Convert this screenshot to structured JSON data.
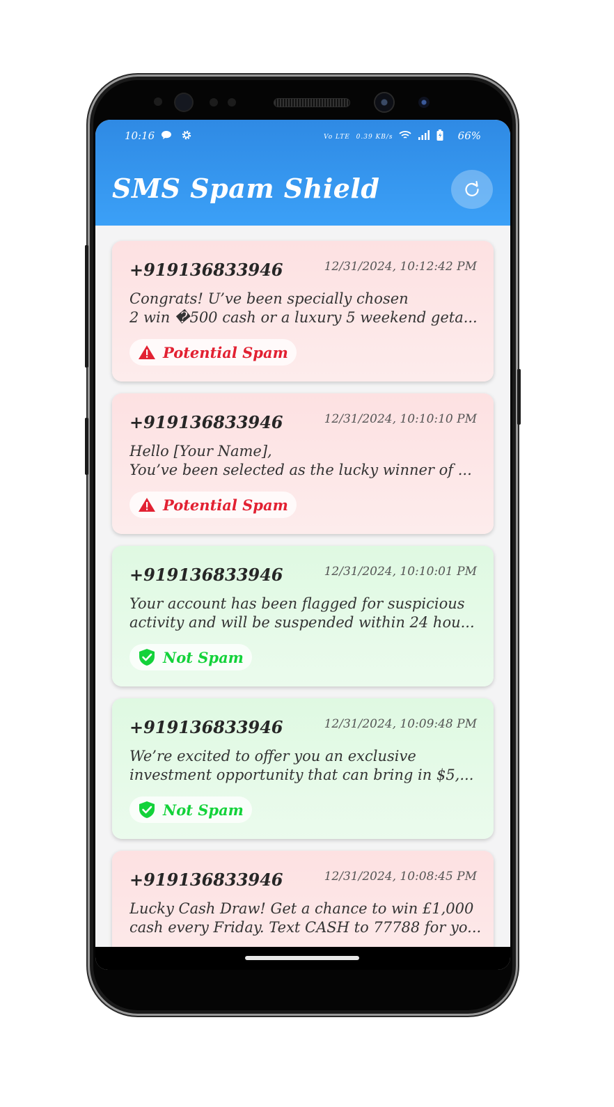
{
  "status_bar": {
    "time": "10:16",
    "left_icons": [
      "chat-bubble-icon",
      "gear-icon"
    ],
    "network_label": "Vo LTE",
    "speed": "0.39 KB/s",
    "battery": "66%"
  },
  "header": {
    "title": "SMS Spam Shield",
    "refresh_icon": "refresh-icon"
  },
  "messages": [
    {
      "sender": "+919136833946",
      "timestamp": "12/31/2024, 10:12:42 PM",
      "line1": "Congrats! U’ve been specially chosen",
      "line2": "2 win �500 cash or a luxury 5 weekend geta...",
      "status": "Potential Spam"
    },
    {
      "sender": "+919136833946",
      "timestamp": "12/31/2024, 10:10:10 PM",
      "line1": "Hello [Your Name],",
      "line2": "You’ve been selected as the lucky winner of ...",
      "status": "Potential Spam"
    },
    {
      "sender": "+919136833946",
      "timestamp": "12/31/2024, 10:10:01 PM",
      "line1": "Your account has been flagged for suspicious",
      "line2": "activity and will be suspended within 24 hou...",
      "status": "Not Spam"
    },
    {
      "sender": "+919136833946",
      "timestamp": "12/31/2024, 10:09:48 PM",
      "line1": "We’re excited to offer you an exclusive",
      "line2": "investment opportunity that can bring in $5,...",
      "status": "Not Spam"
    },
    {
      "sender": "+919136833946",
      "timestamp": "12/31/2024, 10:08:45 PM",
      "line1": "Lucky Cash Draw! Get a chance to win £1,000",
      "line2": "cash every Friday. Text CASH to 77788 for yo...",
      "status": ""
    }
  ],
  "colors": {
    "header_blue": "#3396ee",
    "spam_red": "#e22132",
    "safe_green": "#13d23a"
  }
}
